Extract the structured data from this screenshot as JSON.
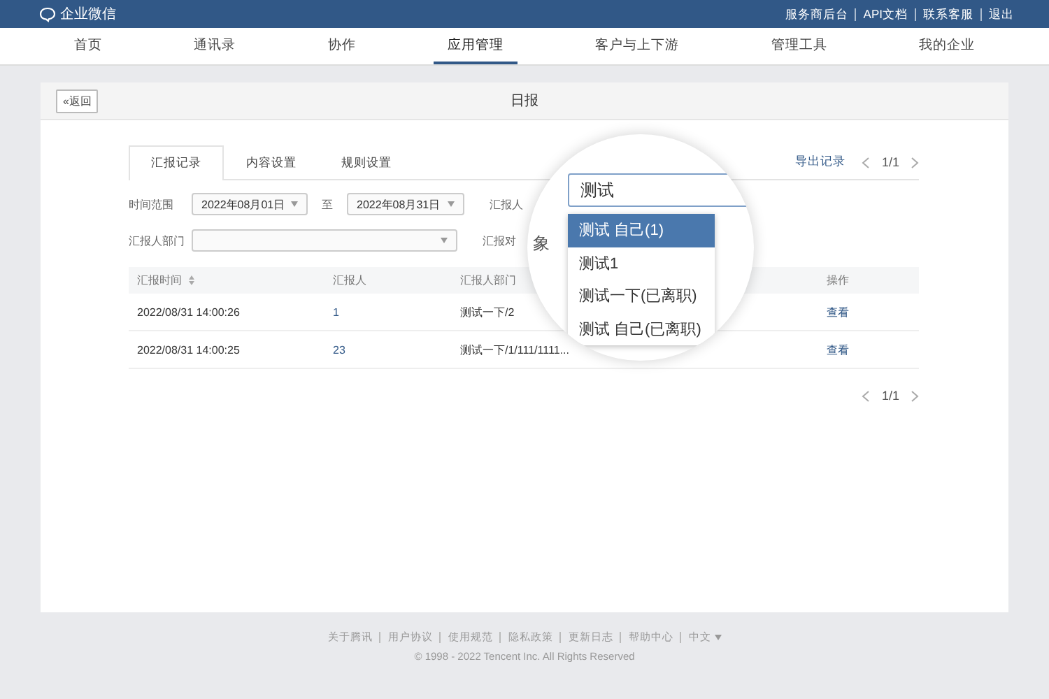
{
  "topbar": {
    "logo": "企业微信",
    "links": [
      "服务商后台",
      "API文档",
      "联系客服",
      "退出"
    ]
  },
  "nav": [
    {
      "label": "首页",
      "selected": false
    },
    {
      "label": "通讯录",
      "selected": false
    },
    {
      "label": "协作",
      "selected": false
    },
    {
      "label": "应用管理",
      "selected": true
    },
    {
      "label": "客户与上下游",
      "selected": false
    },
    {
      "label": "管理工具",
      "selected": false
    },
    {
      "label": "我的企业",
      "selected": false
    }
  ],
  "page": {
    "back": "«返回",
    "title": "日报"
  },
  "tabs": [
    {
      "label": "汇报记录",
      "selected": true
    },
    {
      "label": "内容设置",
      "selected": false
    },
    {
      "label": "规则设置",
      "selected": false
    }
  ],
  "export": "导出记录",
  "pager_top": "1/1",
  "pager_bottom": "1/1",
  "filters": {
    "time_label": "时间范围",
    "start": "2022年08月01日",
    "to": "至",
    "end": "2022年08月31日",
    "reporter_label": "汇报人",
    "dept_label": "汇报人部门",
    "target_label": "汇报对"
  },
  "table": {
    "columns": [
      "汇报时间",
      "汇报人",
      "汇报人部门",
      "操作"
    ],
    "rows": [
      {
        "time": "2022/08/31 14:00:26",
        "reporter": "1",
        "dept": "测试一下/2",
        "action": "查看"
      },
      {
        "time": "2022/08/31 14:00:25",
        "reporter": "23",
        "dept": "测试一下/1/111/1111...",
        "action": "查看"
      }
    ]
  },
  "magnifier": {
    "label_tail": "象",
    "search_value": "测试",
    "options": [
      {
        "label": "测试 自己(1)",
        "selected": true
      },
      {
        "label": "测试1",
        "selected": false
      },
      {
        "label": "测试一下(已离职)",
        "selected": false
      },
      {
        "label": "测试 自己(已离职)",
        "selected": false
      }
    ]
  },
  "footer": {
    "links": [
      "关于腾讯",
      "用户协议",
      "使用规范",
      "隐私政策",
      "更新日志",
      "帮助中心"
    ],
    "language": "中文",
    "copyright": "© 1998 - 2022 Tencent Inc. All Rights Reserved"
  }
}
